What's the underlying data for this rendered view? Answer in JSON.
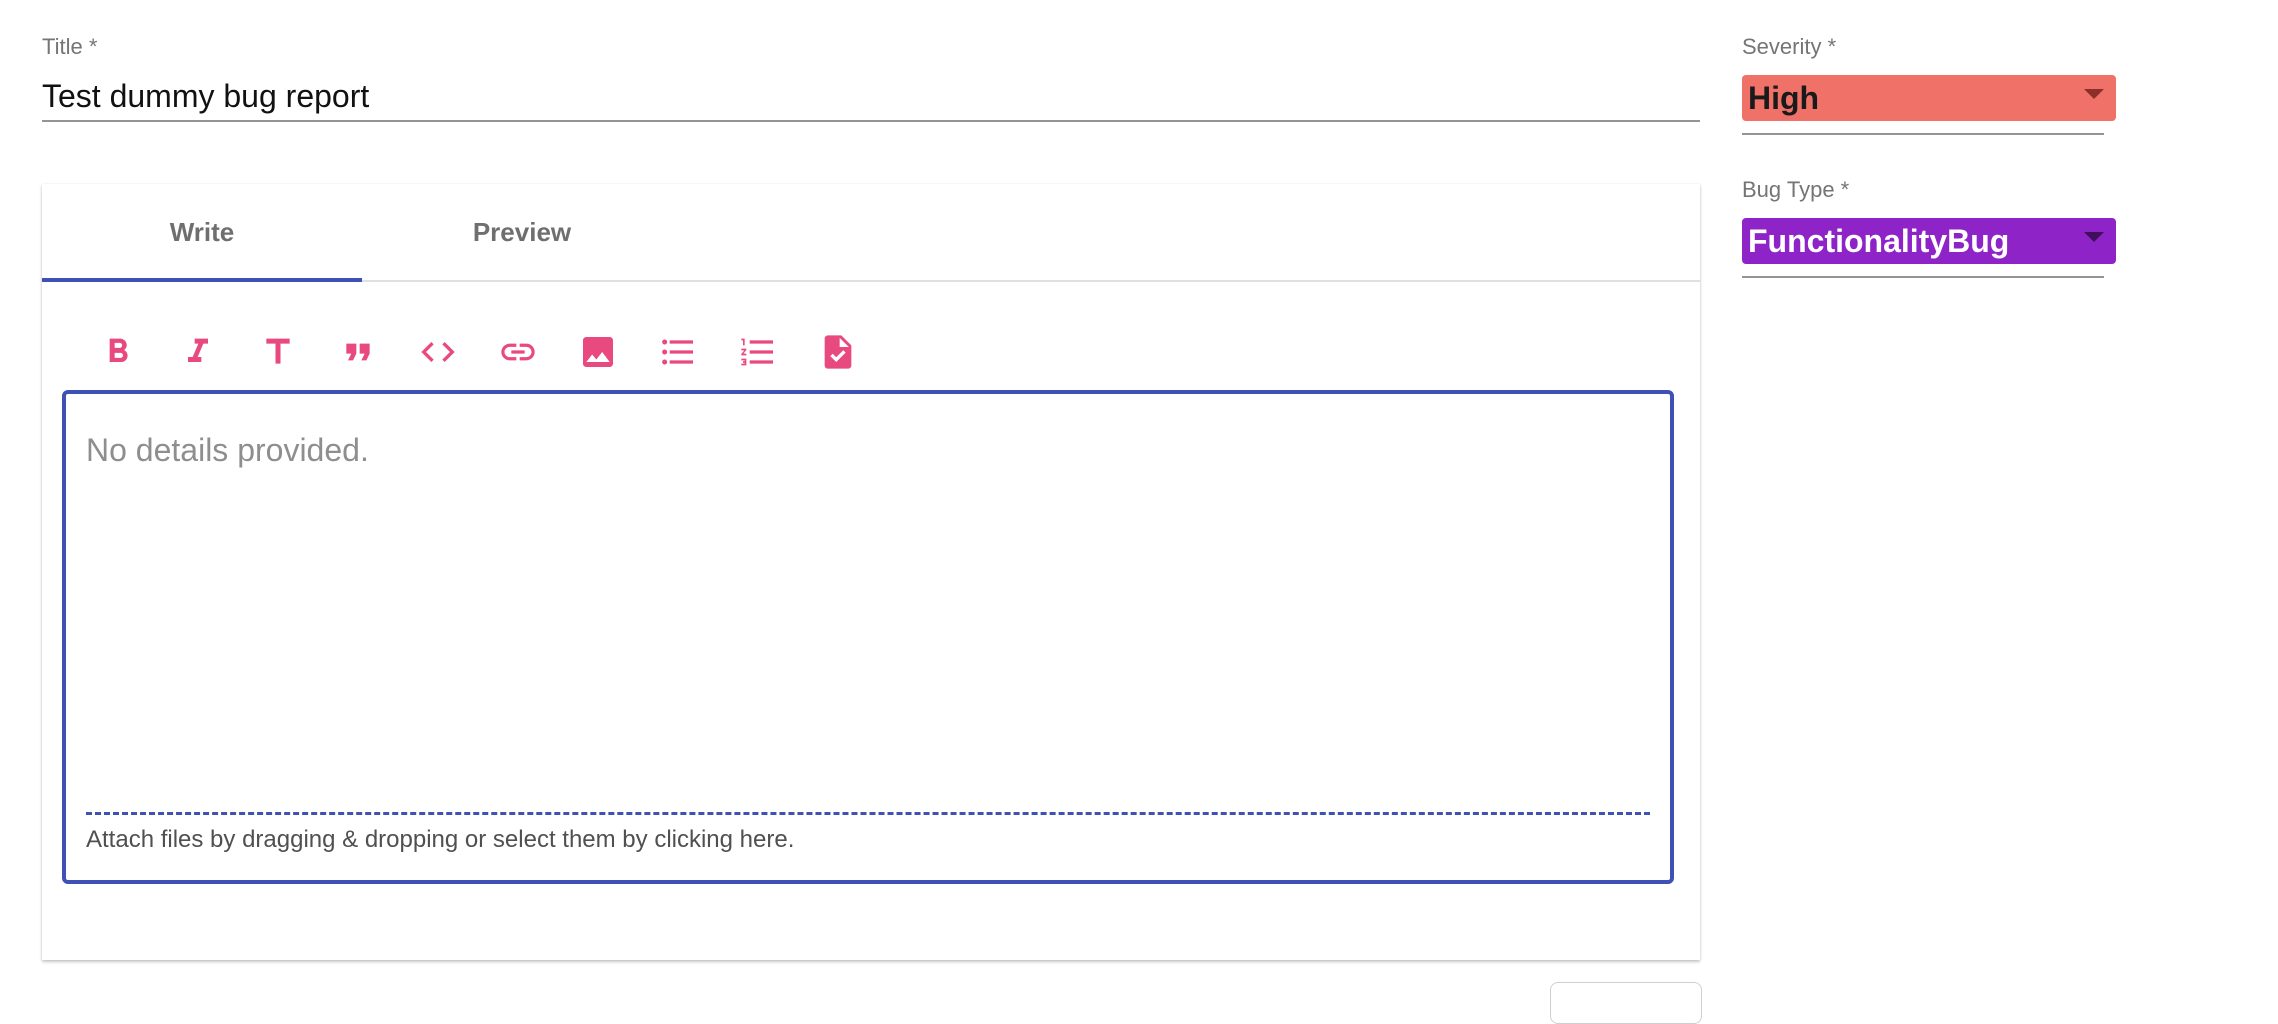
{
  "title_field": {
    "label": "Title *",
    "value": "Test dummy bug report"
  },
  "editor": {
    "tabs": [
      {
        "label": "Write",
        "active": true
      },
      {
        "label": "Preview",
        "active": false
      }
    ],
    "toolbar_icons": [
      "bold-icon",
      "italic-icon",
      "header-icon",
      "quote-icon",
      "code-icon",
      "link-icon",
      "image-icon",
      "unordered-list-icon",
      "ordered-list-icon",
      "checked-list-icon"
    ],
    "content": "No details provided.",
    "dropzone_text": "Attach files by dragging & dropping or select them by clicking here."
  },
  "severity": {
    "label": "Severity *",
    "value": "High",
    "color": "#ef7168"
  },
  "bug_type": {
    "label": "Bug Type *",
    "value": "FunctionalityBug",
    "color": "#8e24c8"
  },
  "colors": {
    "toolbar_icon": "#e8497f",
    "accent": "#3f51b5"
  }
}
